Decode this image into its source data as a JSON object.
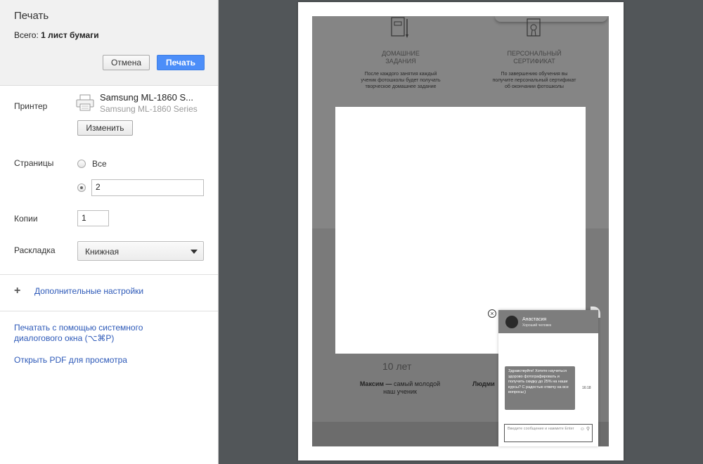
{
  "panel": {
    "title": "Печать",
    "total_label": "Всего:",
    "total_value": "1 лист бумаги",
    "cancel_label": "Отмена",
    "print_label": "Печать",
    "printer_label": "Принтер",
    "printer_name": "Samsung ML-1860 S...",
    "printer_model": "Samsung ML-1860 Series",
    "change_label": "Изменить",
    "pages_label": "Страницы",
    "pages_all": "Все",
    "pages_value": "2",
    "copies_label": "Копии",
    "copies_value": "1",
    "layout_label": "Раскладка",
    "layout_value": "Книжная",
    "more_settings": "Дополнительные настройки",
    "system_dialog_line1": "Печатать с помощью системного",
    "system_dialog_line2": "диалогового окна (⌥⌘P)",
    "open_pdf": "Открыть PDF для просмотра"
  },
  "preview": {
    "feature1_title1": "ДОМАШНИЕ",
    "feature1_title2": "ЗАДАНИЯ",
    "feature1_text": "После каждого занятия каждый ученик фотошколы будет получать творческое домашнее задание",
    "feature2_title1": "ПЕРСОНАЛЬНЫЙ",
    "feature2_title2": "СЕРТИФИКАТ",
    "feature2_text": "По завершению обучения вы получите персональный сертификат об окончании фотошколы",
    "years": "10 лет",
    "person_name": "Максим —",
    "person_text": " самый молодой наш ученик",
    "person2": "Людми",
    "chat": {
      "agent_name": "Анастасия",
      "agent_role": "Хороший человек",
      "message": "Здравствуйте! Хотите научиться здорово фотографировать и получить скидку до 25% на наши курсы? С радостью отвечу на все вопросы;)",
      "time": "16:18",
      "input_placeholder": "Введите сообщение и нажмите Enter"
    }
  }
}
